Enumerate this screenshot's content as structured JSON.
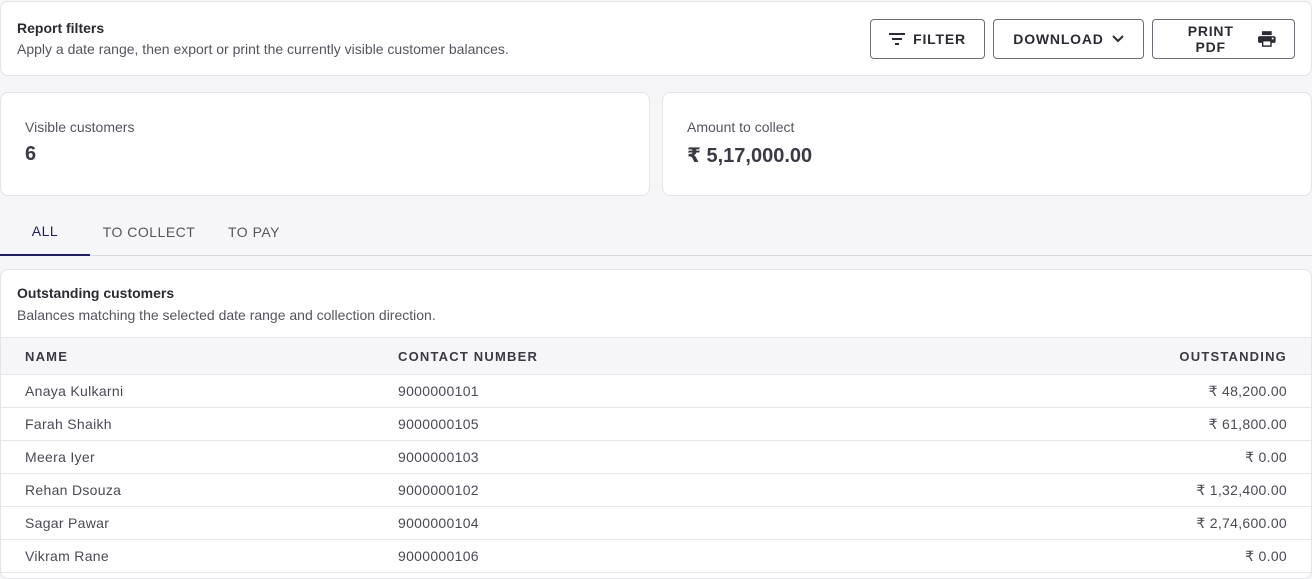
{
  "filters": {
    "title": "Report filters",
    "description": "Apply a date range, then export or print the currently visible customer balances.",
    "filter_label": "FILTER",
    "download_label": "DOWNLOAD",
    "print_label": "PRINT PDF"
  },
  "stats": {
    "visible_label": "Visible customers",
    "visible_value": "6",
    "amount_label": "Amount to collect",
    "amount_value": "₹ 5,17,000.00"
  },
  "tabs": [
    {
      "label": "ALL",
      "active": true
    },
    {
      "label": "TO COLLECT",
      "active": false
    },
    {
      "label": "TO PAY",
      "active": false
    }
  ],
  "table": {
    "title": "Outstanding customers",
    "description": "Balances matching the selected date range and collection direction.",
    "columns": [
      "NAME",
      "CONTACT NUMBER",
      "OUTSTANDING"
    ],
    "rows": [
      {
        "name": "Anaya Kulkarni",
        "contact": "9000000101",
        "outstanding": "₹ 48,200.00"
      },
      {
        "name": "Farah Shaikh",
        "contact": "9000000105",
        "outstanding": "₹ 61,800.00"
      },
      {
        "name": "Meera Iyer",
        "contact": "9000000103",
        "outstanding": "₹ 0.00"
      },
      {
        "name": "Rehan Dsouza",
        "contact": "9000000102",
        "outstanding": "₹ 1,32,400.00"
      },
      {
        "name": "Sagar Pawar",
        "contact": "9000000104",
        "outstanding": "₹ 2,74,600.00"
      },
      {
        "name": "Vikram Rane",
        "contact": "9000000106",
        "outstanding": "₹ 0.00"
      }
    ]
  },
  "icons": {
    "filter": "filter-lines-icon",
    "download": "chevron-down-icon",
    "print": "printer-icon"
  }
}
